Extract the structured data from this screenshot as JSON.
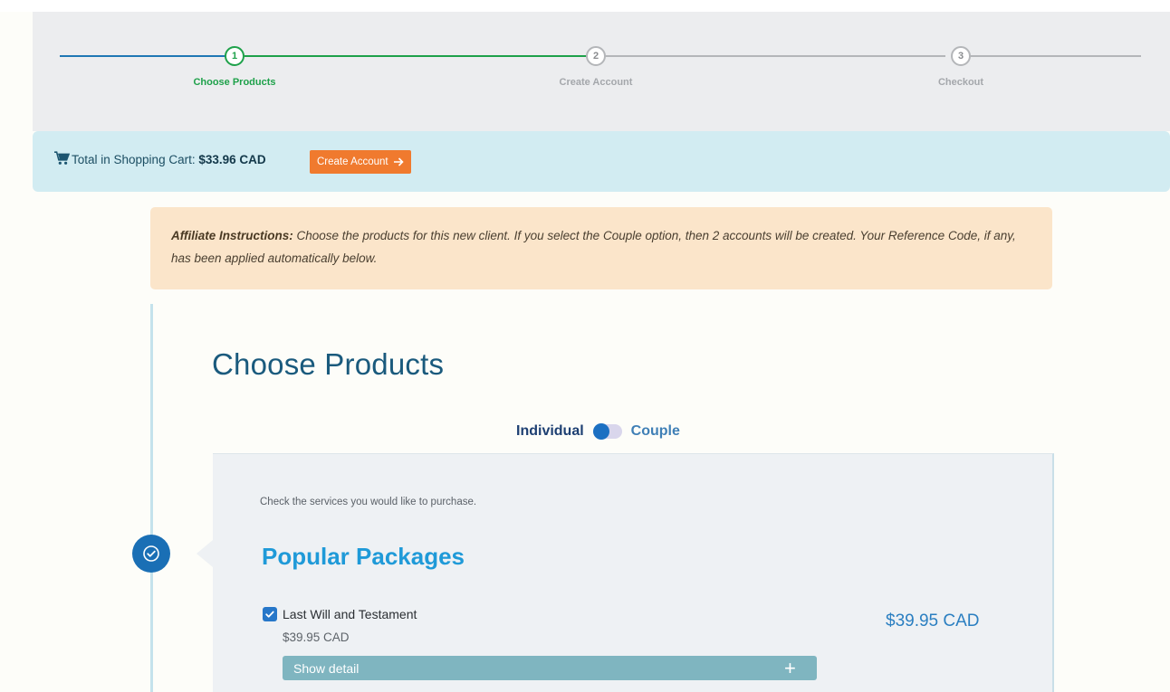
{
  "stepper": {
    "steps": [
      {
        "number": "1",
        "label": "Choose Products",
        "state": "active"
      },
      {
        "number": "2",
        "label": "Create Account",
        "state": "upcoming"
      },
      {
        "number": "3",
        "label": "Checkout",
        "state": "upcoming"
      }
    ]
  },
  "cart": {
    "icon": "shopping-cart-icon",
    "label": "Total in Shopping Cart:",
    "amount": "$33.96 CAD",
    "create_button": "Create Account",
    "create_button_icon": "arrow-right-icon"
  },
  "instructions": {
    "lead": "Affiliate Instructions:",
    "text": " Choose the products for this new client. If you select the Couple option, then 2 accounts will be created. Your Reference Code, if any, has been applied automatically below."
  },
  "page": {
    "title": "Choose Products",
    "timeline_icon": "check-circle-icon"
  },
  "plan_toggle": {
    "left": "Individual",
    "right": "Couple",
    "selected": "Individual"
  },
  "products": {
    "hint": "Check the services you would like to purchase.",
    "section_title": "Popular Packages",
    "items": [
      {
        "name": "Last Will and Testament",
        "checked": true,
        "sub_price": "$39.95 CAD",
        "price": "$39.95 CAD",
        "detail_label": "Show detail",
        "detail_icon": "plus-icon"
      }
    ]
  },
  "colors": {
    "accent_blue": "#1f77b4",
    "step_green": "#1ea14a",
    "cart_bar": "#d2ecf2",
    "button_orange": "#f07a2e",
    "instructions_bg": "#fbe5ca",
    "section_title_blue": "#1f9ad8",
    "detail_bar": "#7fb5c0"
  }
}
